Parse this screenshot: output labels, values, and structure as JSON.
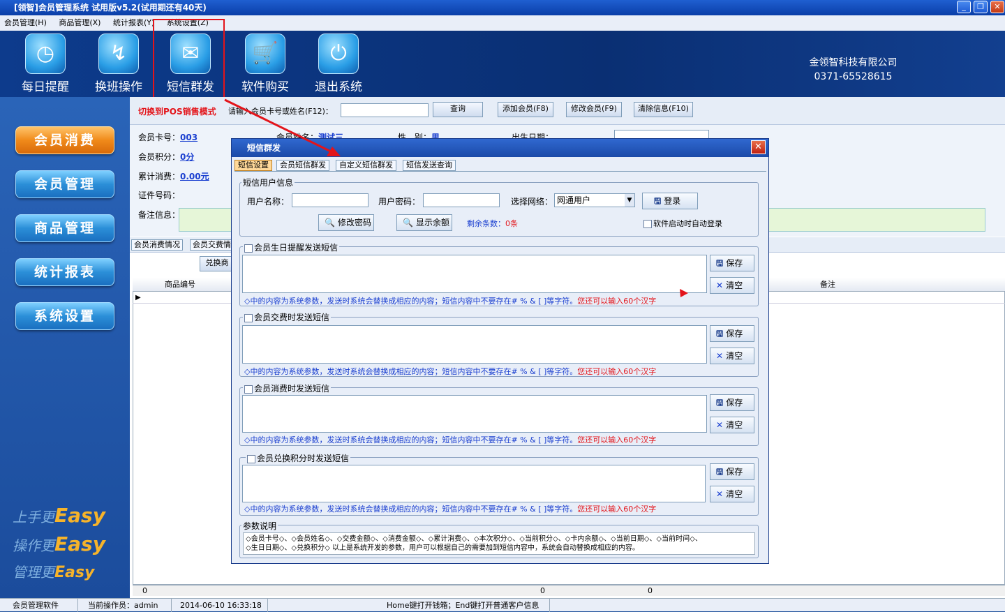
{
  "window": {
    "title": "[领智]会员管理系统 试用版v5.2(试用期还有40天)",
    "min": "_",
    "max": "❐",
    "close": "✕"
  },
  "menu": [
    "会员管理(H)",
    "商品管理(X)",
    "统计报表(Y)",
    "系统设置(Z)"
  ],
  "toolbar": [
    {
      "label": "每日提醒",
      "icon": "clock-icon",
      "glyph": "◷"
    },
    {
      "label": "换班操作",
      "icon": "shift-icon",
      "glyph": "↯"
    },
    {
      "label": "短信群发",
      "icon": "mail-icon",
      "glyph": "✉"
    },
    {
      "label": "软件购买",
      "icon": "cart-icon",
      "glyph": "🛒"
    },
    {
      "label": "退出系统",
      "icon": "power-icon",
      "glyph": "⏻"
    }
  ],
  "company": {
    "name": "金领智科技有限公司",
    "phone": "0371-65528615"
  },
  "nav": [
    "会员消费",
    "会员管理",
    "商品管理",
    "统计报表",
    "系统设置"
  ],
  "slogans": [
    {
      "prefix": "上手更",
      "word": "Easy"
    },
    {
      "prefix": "操作更",
      "word": "Easy"
    },
    {
      "prefix": "管理更",
      "word": "Easy"
    }
  ],
  "topbar": {
    "pos_link": "切换到POS销售模式",
    "search_label": "请输入会员卡号或姓名(F12)：",
    "search_value": "",
    "query": "查询",
    "add": "添加会员(F8)",
    "edit": "修改会员(F9)",
    "clear": "清除信息(F10)"
  },
  "member": {
    "card_label": "会员卡号：",
    "card": "003",
    "points_label": "会员积分：",
    "points": "0分",
    "total_label": "累计消费：",
    "total": "0.00元",
    "id_label": "证件号码：",
    "remark_label": "备注信息：",
    "name_label": "会员姓名：",
    "name": "测试三",
    "gender_label": "性　别：",
    "gender": "男",
    "birth_label": "出生日期："
  },
  "subtabs": [
    "会员消费情况",
    "会员交费情"
  ],
  "exchange_btn": "兑换商",
  "grid": {
    "headers": [
      "商品编号",
      "备注"
    ],
    "footer": [
      "0",
      "0",
      "0"
    ]
  },
  "status": {
    "app": "会员管理软件",
    "operator": "当前操作员：admin",
    "datetime": "2014-06-10 16:33:18",
    "hint": "Home键打开钱箱；End键打开普通客户信息"
  },
  "dialog": {
    "title": "短信群发",
    "close": "✕",
    "tabs": [
      "短信设置",
      "会员短信群发",
      "自定义短信群发",
      "短信发送查询"
    ],
    "user_group": "短信用户信息",
    "username_label": "用户名称：",
    "username": "",
    "password_label": "用户密码：",
    "password": "",
    "network_label": "选择网络：",
    "network": "网通用户",
    "login": "登录",
    "change_pwd": "修改密码",
    "show_balance": "显示余额",
    "remaining": "剩余条数：",
    "remaining_value": "0条",
    "autologin": "软件启动时自动登录",
    "sections": [
      {
        "title": "会员生日提醒发送短信"
      },
      {
        "title": "会员交费时发送短信"
      },
      {
        "title": "会员消费时发送短信"
      },
      {
        "title": "会员兑换积分时发送短信"
      }
    ],
    "note_main": "◇中的内容为系统参数，发送时系统会替换成相应的内容；短信内容中不要存在# % & [ ]等字符。",
    "note_red": "您还可以输入60个汉字",
    "save": "保存",
    "clear": "清空",
    "param_group": "参数说明",
    "param_line1": "◇会员卡号◇、◇会员姓名◇、◇交费金额◇、◇消费金额◇、◇累计消费◇、◇本次积分◇、◇当前积分◇、◇卡内余额◇、◇当前日期◇、◇当前时间◇、",
    "param_line2": "◇生日日期◇、◇兑换积分◇ 以上是系统开发的参数，用户可以根据自己的需要加到短信内容中，系统会自动替换成相应的内容。"
  },
  "colors": {
    "accent": "#1d4f9a",
    "highlight": "#e3141a",
    "link": "#1a3fd0"
  }
}
